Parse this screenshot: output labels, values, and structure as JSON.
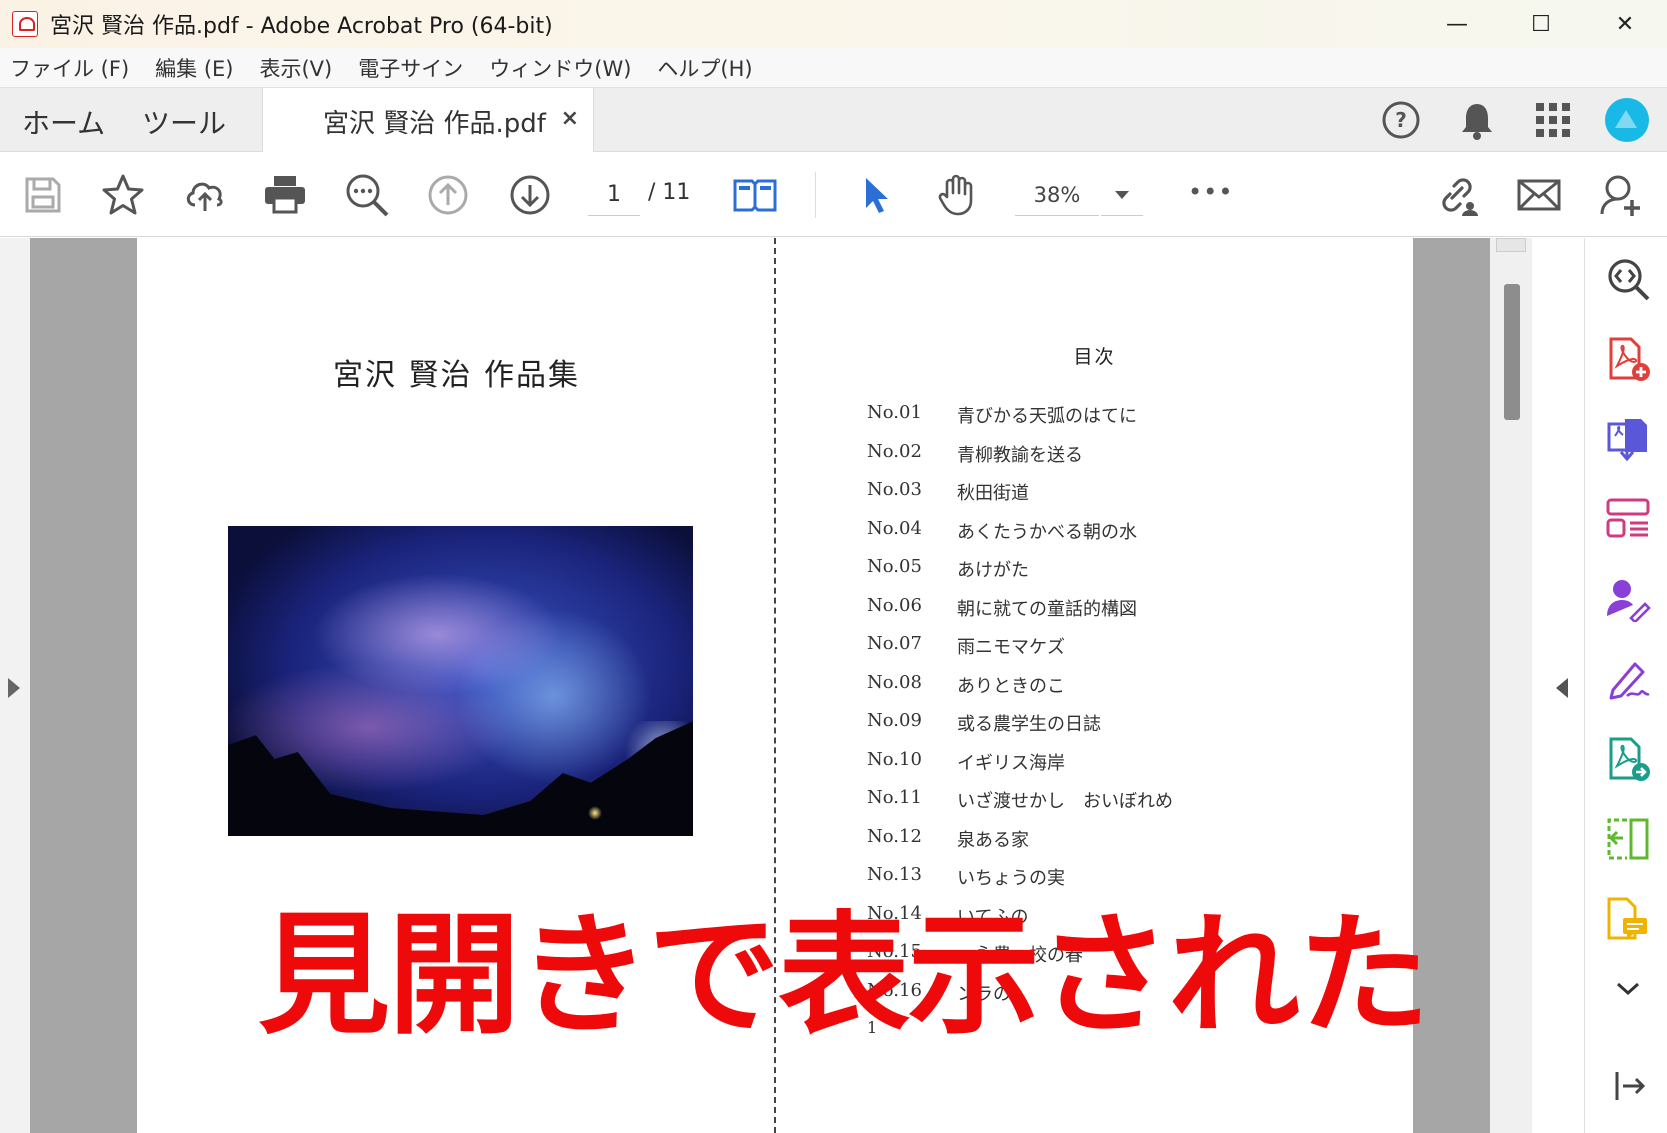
{
  "window": {
    "title": "宮沢 賢治 作品.pdf - Adobe Acrobat Pro (64-bit)",
    "controls": {
      "minimize": "—",
      "maximize": "☐",
      "close": "✕"
    }
  },
  "menu": [
    "ファイル (F)",
    "編集 (E)",
    "表示(V)",
    "電子サイン",
    "ウィンドウ(W)",
    "ヘルプ(H)"
  ],
  "tabs": {
    "home": "ホーム",
    "tools": "ツール",
    "document": "宮沢 賢治 作品.pdf",
    "close_glyph": "×"
  },
  "toolbar": {
    "current_page": "1",
    "total_pages": "/ 11",
    "zoom": "38%",
    "more": "•••"
  },
  "document": {
    "left_page": {
      "title": "宮沢  賢治  作品集"
    },
    "right_page": {
      "heading": "目次",
      "toc": [
        {
          "no": "No.01",
          "title": "青びかる天弧のはてに"
        },
        {
          "no": "No.02",
          "title": "青柳教諭を送る"
        },
        {
          "no": "No.03",
          "title": "秋田街道"
        },
        {
          "no": "No.04",
          "title": "あくたうかべる朝の水"
        },
        {
          "no": "No.05",
          "title": "あけがた"
        },
        {
          "no": "No.06",
          "title": "朝に就ての童話的構図"
        },
        {
          "no": "No.07",
          "title": "雨ニモマケズ"
        },
        {
          "no": "No.08",
          "title": "ありときのこ"
        },
        {
          "no": "No.09",
          "title": "或る農学生の日誌"
        },
        {
          "no": "No.10",
          "title": "イギリス海岸"
        },
        {
          "no": "No.11",
          "title": "いざ渡せかし　おいぼれめ"
        },
        {
          "no": "No.12",
          "title": "泉ある家"
        },
        {
          "no": "No.13",
          "title": "いちょうの実"
        },
        {
          "no": "No.14",
          "title": "いてふの"
        },
        {
          "no": "No.15",
          "title": "ー永農　校の春"
        },
        {
          "no": "No.16",
          "title": "ンラの"
        }
      ],
      "page_number": "1"
    }
  },
  "overlay_caption": "見開きで表示された",
  "colors": {
    "accent_blue": "#2b6fd6",
    "caption_red": "#ee0a0a",
    "workspace_gray": "#a6a6a6"
  }
}
